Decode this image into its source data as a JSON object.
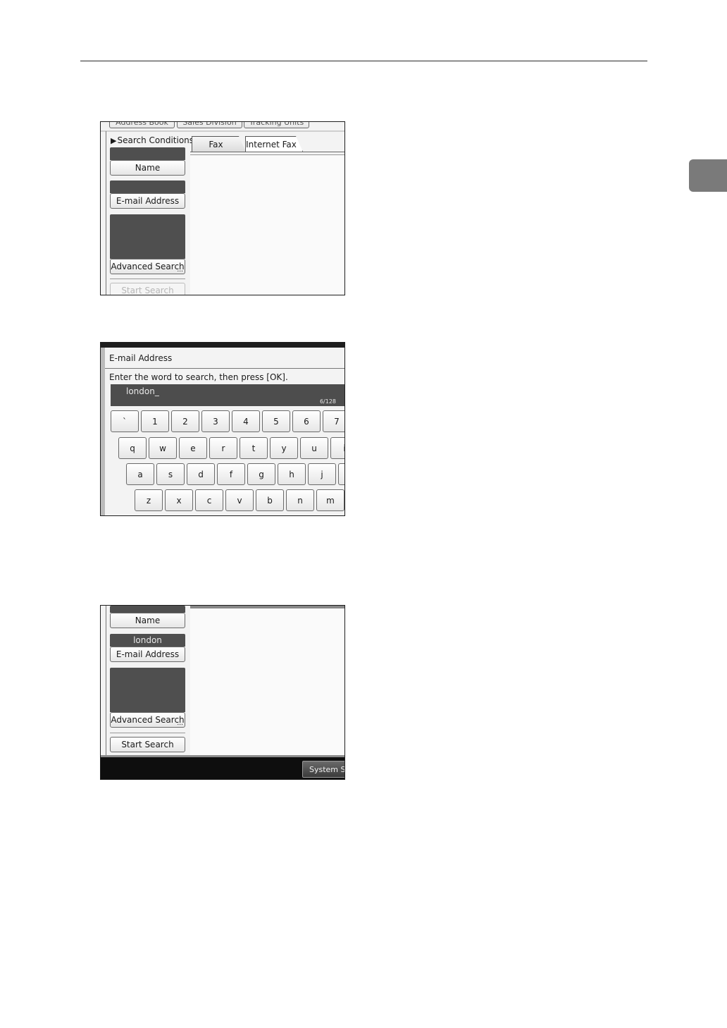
{
  "screen1": {
    "top_tabs": [
      "Address Book",
      "Sales Division",
      "Tracking Units"
    ],
    "search_conditions_label": "Search Conditions",
    "tabs": [
      "Fax",
      "Internet Fax"
    ],
    "name_value": "",
    "name_button": "Name",
    "email_value": "",
    "email_button": "E-mail Address",
    "advanced_search_button": "Advanced Search",
    "start_search_button": "Start Search",
    "ellipsis": "..."
  },
  "screen2": {
    "title": "E-mail Address",
    "instruction": "Enter the word to search, then press [OK].",
    "input_value": "london_",
    "char_count": "6/128",
    "keyboard_rows": [
      [
        "`",
        "1",
        "2",
        "3",
        "4",
        "5",
        "6",
        "7"
      ],
      [
        "q",
        "w",
        "e",
        "r",
        "t",
        "y",
        "u",
        "i"
      ],
      [
        "a",
        "s",
        "d",
        "f",
        "g",
        "h",
        "j",
        "k"
      ],
      [
        "z",
        "x",
        "c",
        "v",
        "b",
        "n",
        "m"
      ]
    ]
  },
  "screen3": {
    "name_button": "Name",
    "email_value": "london",
    "email_button": "E-mail Address",
    "advanced_search_button": "Advanced Search",
    "start_search_button": "Start Search",
    "system_status_button": "System Status",
    "ellipsis": "..."
  }
}
